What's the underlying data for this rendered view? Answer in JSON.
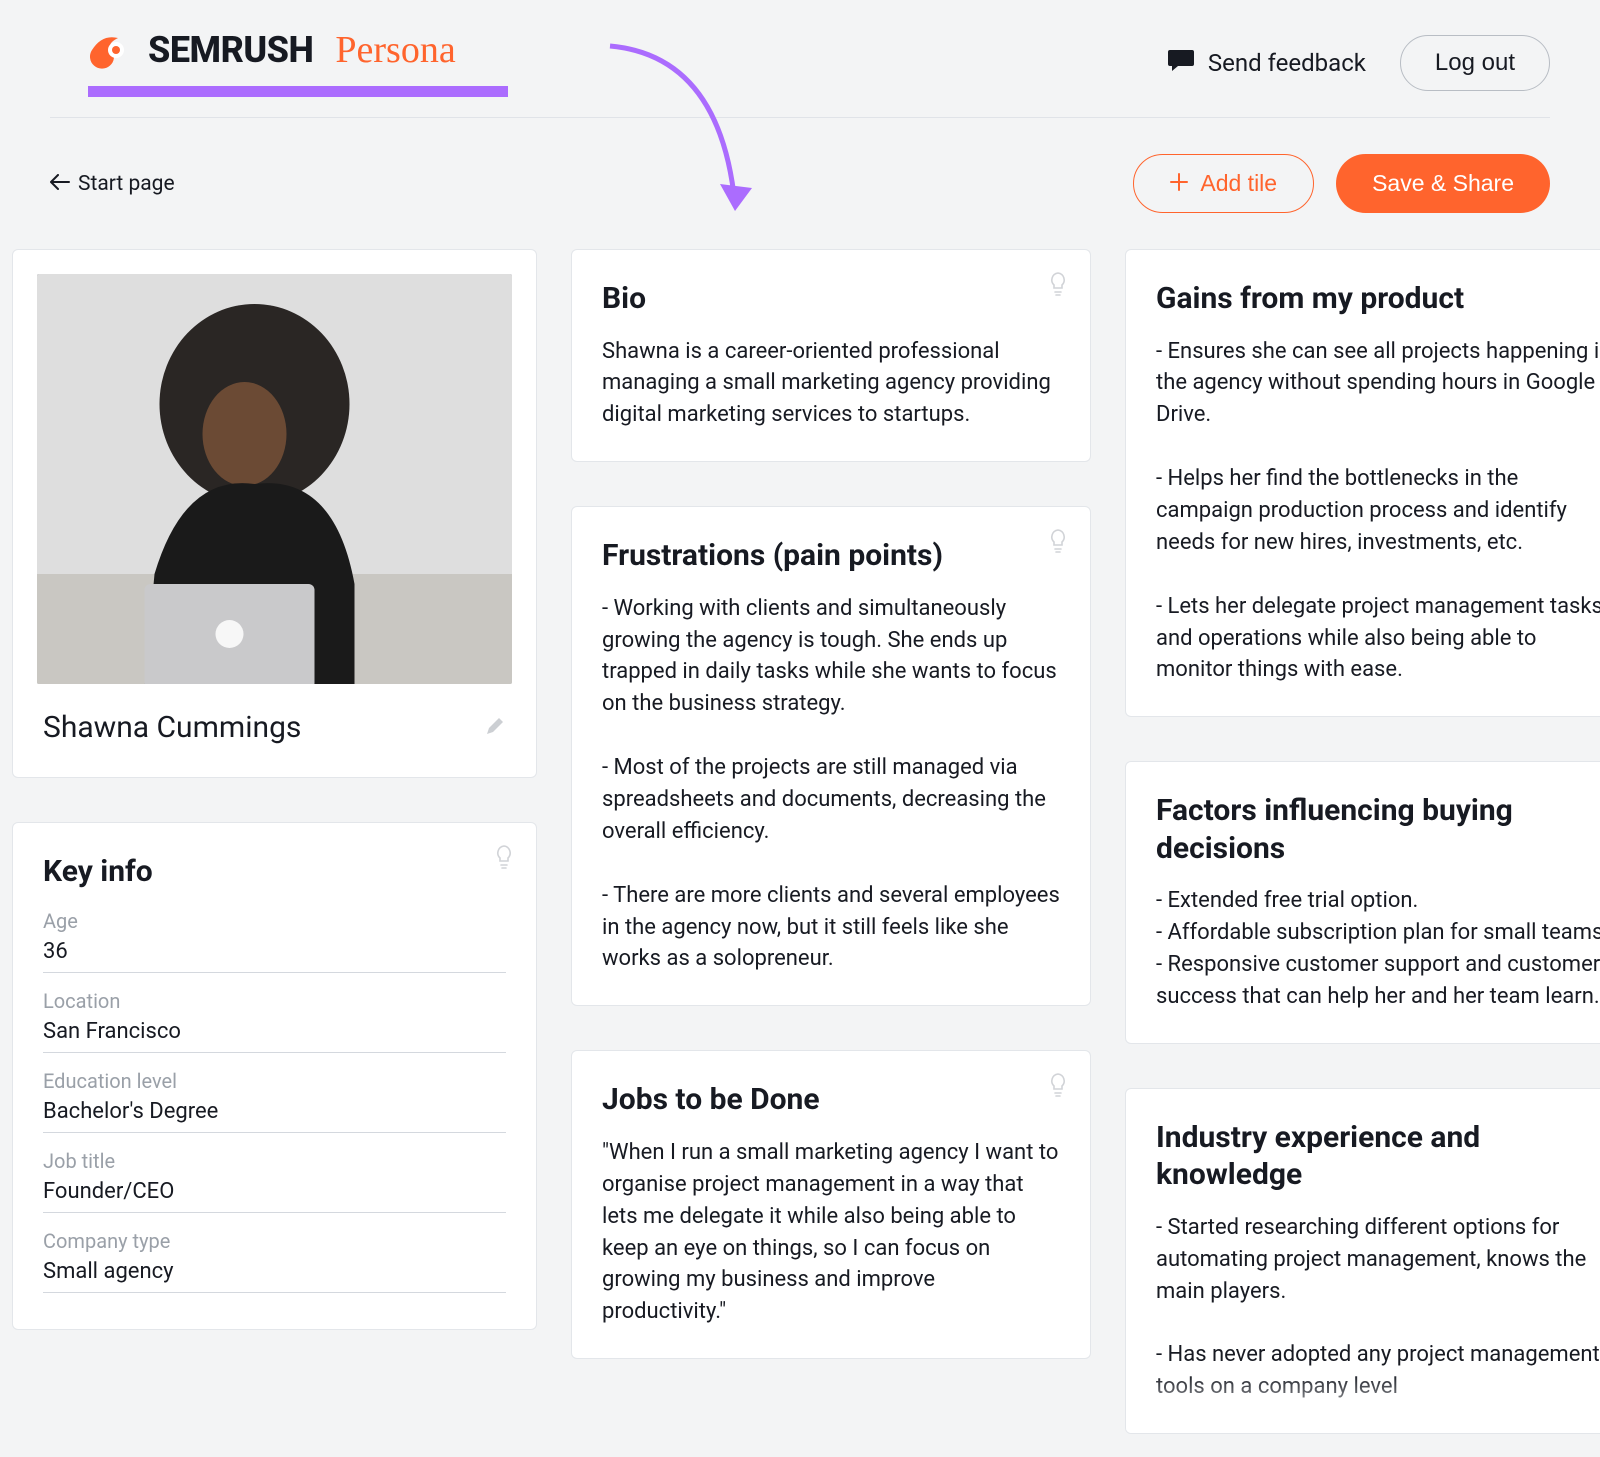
{
  "brand": {
    "main": "SEMRUSH",
    "sub": "Persona"
  },
  "header": {
    "feedback": "Send feedback",
    "logout": "Log out"
  },
  "toolbar": {
    "start": "Start page",
    "add_tile": "Add tile",
    "save": "Save & Share"
  },
  "persona": {
    "name": "Shawna Cummings"
  },
  "keyinfo": {
    "title": "Key info",
    "fields": [
      {
        "label": "Age",
        "value": "36"
      },
      {
        "label": "Location",
        "value": "San Francisco"
      },
      {
        "label": "Education level",
        "value": "Bachelor's Degree"
      },
      {
        "label": "Job title",
        "value": "Founder/CEO"
      },
      {
        "label": "Company type",
        "value": "Small agency"
      }
    ]
  },
  "bio": {
    "title": "Bio",
    "body": "Shawna is a career-oriented professional managing a small marketing agency providing digital marketing services to startups."
  },
  "frustrations": {
    "title": "Frustrations (pain points)",
    "body": "- Working with clients and simultaneously growing the agency is tough. She ends up trapped in daily tasks while she wants to focus on the business strategy.\n\n- Most of the projects are still managed via spreadsheets and documents, decreasing the overall efficiency.\n\n- There are more clients and several employees in the agency now, but it still feels like she works as a solopreneur."
  },
  "jobs": {
    "title": "Jobs to be Done",
    "body": "\"When I run a small marketing agency I want to organise project management in a way that lets me delegate it while also being able to keep an eye on things, so I can focus on growing my business and improve productivity.\""
  },
  "gains": {
    "title": "Gains from my product",
    "body": "- Ensures she can see all projects happening in the agency without spending hours in Google Drive.\n\n- Helps her find the bottlenecks in the campaign production process and identify needs for new hires, investments, etc.\n\n- Lets her delegate project management tasks and operations while also being able to monitor things with ease."
  },
  "factors": {
    "title": "Factors influencing buying decisions",
    "body": "- Extended free trial option.\n- Affordable subscription plan for small teams.\n- Responsive customer support and customer success that can help her and her team learn."
  },
  "industry": {
    "title": "Industry experience and knowledge",
    "body": "- Started researching different options for automating project management, knows the main players.\n\n- Has never adopted any project management tools on a company level"
  }
}
